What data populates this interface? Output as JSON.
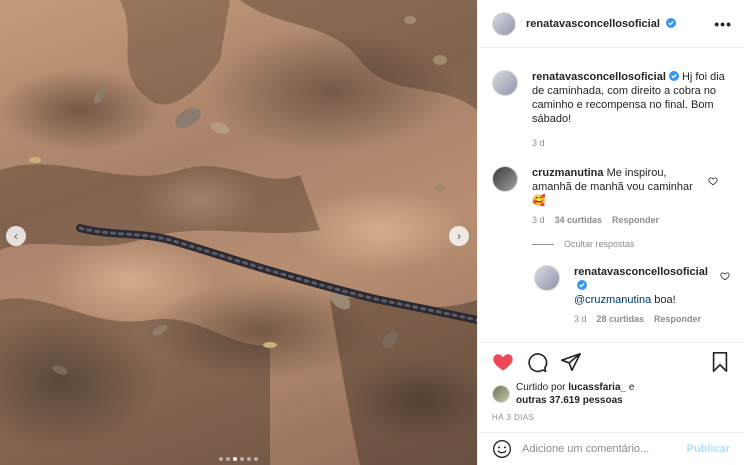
{
  "post": {
    "username": "renatavasconcellosoficial",
    "caption": "Hj foi dia de caminhada, com direito a cobra no caminho e recompensa no final. Bom sábado!",
    "caption_time": "3 d",
    "more_label": "•••"
  },
  "comments": [
    {
      "username": "cruzmanutina",
      "text": "Me inspirou, amanhã de manhã vou caminhar 🥰",
      "time": "3 d",
      "likes": "34 curtidas",
      "reply_label": "Responder"
    }
  ],
  "hide_replies_label": "Ocultar respostas",
  "reply": {
    "username": "renatavasconcellosoficial",
    "mention": "@cruzmanutina",
    "text": " boa!",
    "time": "3 d",
    "likes": "28 curtidas",
    "reply_label": "Responder"
  },
  "likes": {
    "prefix": "Curtido por",
    "user": "lucassfaria_",
    "conj": "e",
    "others": "outras 37.619 pessoas"
  },
  "post_time": "HÁ 3 DIAS",
  "add_comment": {
    "placeholder": "Adicione um comentário...",
    "publish_label": "Publicar"
  },
  "carousel": {
    "prev_label": "‹",
    "next_label": "›",
    "slides": 6,
    "active": 2
  },
  "colors": {
    "heart": "#ed4956",
    "verified": "#3897f0",
    "link": "#00376b",
    "publish": "#b2dffc"
  },
  "icons": {
    "like": "heart-filled-icon",
    "comment": "speech-bubble-icon",
    "share": "paper-plane-icon",
    "save": "bookmark-icon",
    "emoji": "smiley-icon",
    "verified": "verified-badge-icon",
    "more": "ellipsis-icon"
  }
}
